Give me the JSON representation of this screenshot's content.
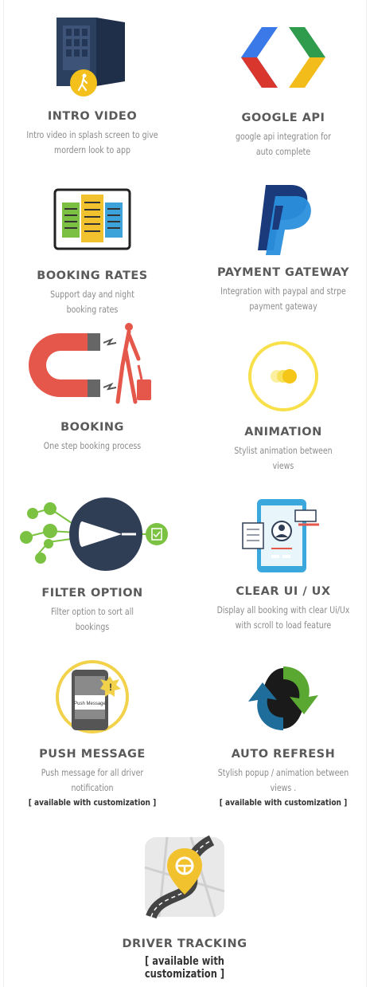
{
  "features": [
    {
      "title": "INTRO VIDEO",
      "desc": [
        "Intro video in splash screen to give",
        "mordern look to app"
      ],
      "icon": "door-walker-icon"
    },
    {
      "title": "GOOGLE API",
      "desc": [
        "google api integration for",
        "auto complete"
      ],
      "icon": "google-api-icon"
    },
    {
      "title": "BOOKING RATES",
      "desc": [
        "Support day and night",
        "booking rates"
      ],
      "icon": "booking-rates-icon"
    },
    {
      "title": "PAYMENT GATEWAY",
      "desc": [
        "Integration with paypal and strpe",
        "payment gateway"
      ],
      "icon": "paypal-icon"
    },
    {
      "title": "BOOKING",
      "desc": [
        "One step booking process"
      ],
      "icon": "magnet-traveler-icon"
    },
    {
      "title": "ANIMATION",
      "desc": [
        "Stylist animation between",
        "views"
      ],
      "icon": "animation-icon"
    },
    {
      "title": "FILTER OPTION",
      "desc": [
        "Filter option to sort all",
        "bookings"
      ],
      "icon": "filter-funnel-icon"
    },
    {
      "title": "CLEAR UI / UX",
      "desc": [
        "Display all booking with clear Ui/Ux",
        "with scroll to load feature"
      ],
      "icon": "phone-profile-icon"
    },
    {
      "title": "PUSH MESSAGE",
      "desc": [
        "Push message for all driver",
        "notification"
      ],
      "note": "[ available with customization ]",
      "icon": "push-message-icon",
      "phone_text": "Push Message"
    },
    {
      "title": "AUTO REFRESH",
      "desc": [
        "Stylish popup / animation between",
        "views ."
      ],
      "note": "[ available with customization ]",
      "icon": "refresh-arrows-icon"
    },
    {
      "title": "DRIVER TRACKING",
      "note": "[ available with customization ]",
      "icon": "map-pin-road-icon"
    }
  ]
}
